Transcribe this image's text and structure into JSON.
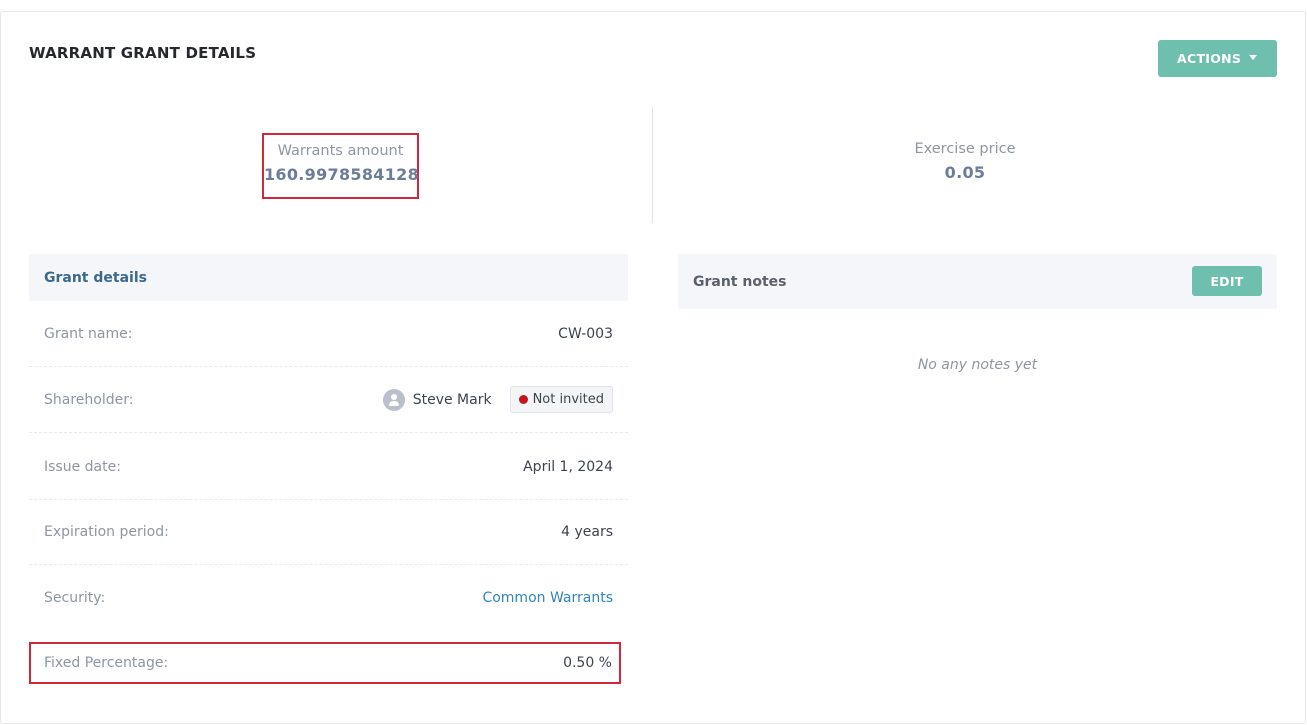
{
  "header": {
    "title": "WARRANT GRANT DETAILS",
    "actions_label": "ACTIONS"
  },
  "stats": {
    "warrants_amount": {
      "label": "Warrants amount",
      "value": "160.9978584128"
    },
    "exercise_price": {
      "label": "Exercise price",
      "value": "0.05"
    }
  },
  "grant_details": {
    "title": "Grant details",
    "rows": {
      "grant_name": {
        "label": "Grant name:",
        "value": "CW-003"
      },
      "shareholder": {
        "label": "Shareholder:",
        "name": "Steve Mark",
        "status": "Not invited"
      },
      "issue_date": {
        "label": "Issue date:",
        "value": "April 1, 2024"
      },
      "expiration": {
        "label": "Expiration period:",
        "value": "4 years"
      },
      "security": {
        "label": "Security:",
        "value": "Common Warrants"
      },
      "fixed_percentage": {
        "label": "Fixed Percentage:",
        "value": "0.50 %"
      }
    }
  },
  "grant_notes": {
    "title": "Grant notes",
    "edit_label": "EDIT",
    "empty_text": "No any notes yet"
  },
  "colors": {
    "accent": "#6fbfae",
    "link": "#2f86b7",
    "highlight_border": "#d0283a",
    "status_dot": "#c4161c"
  }
}
